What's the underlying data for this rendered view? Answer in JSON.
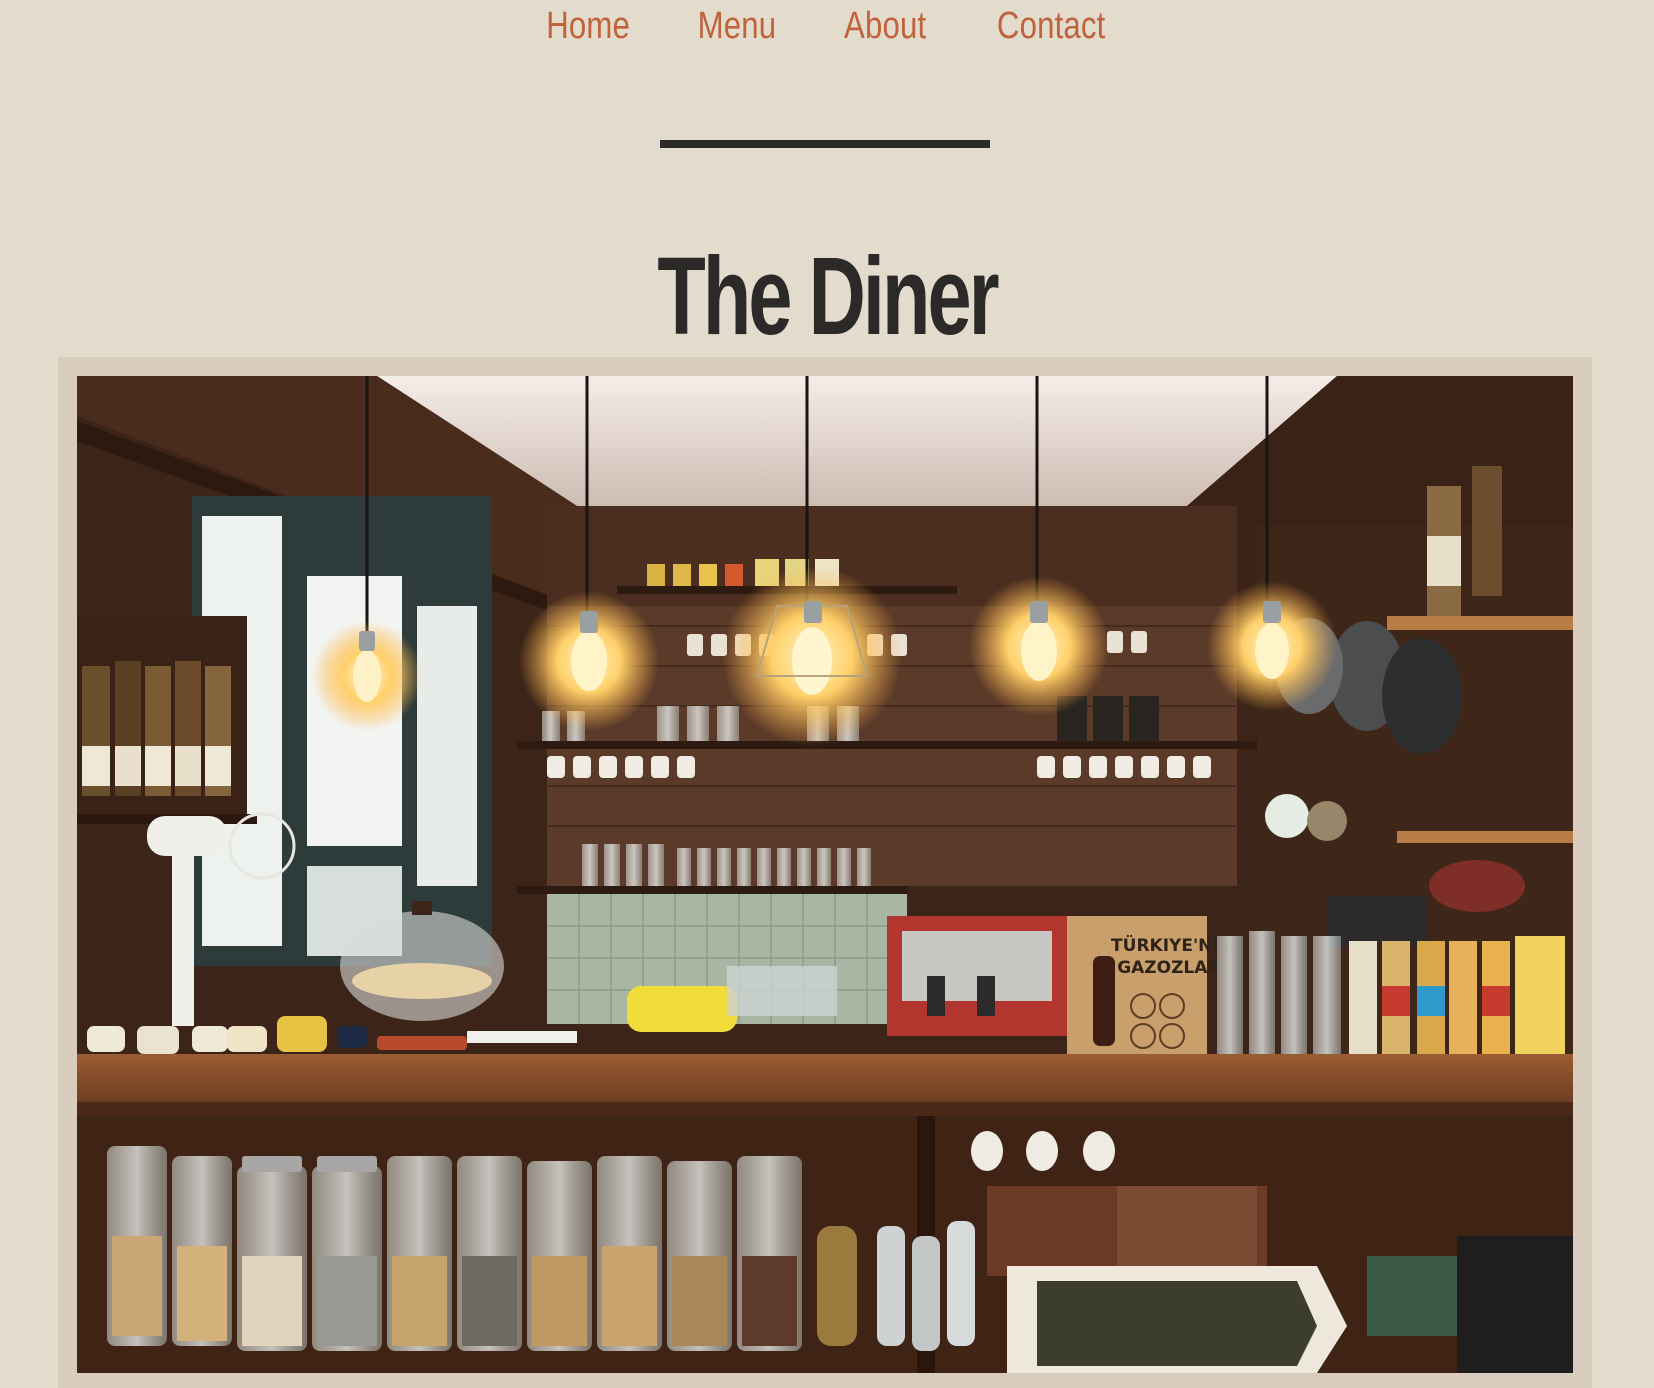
{
  "nav": {
    "items": [
      "Home",
      "Menu",
      "About",
      "Contact"
    ]
  },
  "hero": {
    "title": "The Diner",
    "photo_alt": "Warm, rustic diner counter with hanging Edison bulbs, wooden shelves, cups, glasses, jars and bottles",
    "box_label_line1": "TÜRKIYE'NİN",
    "box_label_line2": "GAZOZLARI"
  },
  "colors": {
    "background": "#e3dbcc",
    "nav_link": "#c0633c",
    "title": "#2b2a28",
    "frame": "#d8cdbd"
  }
}
